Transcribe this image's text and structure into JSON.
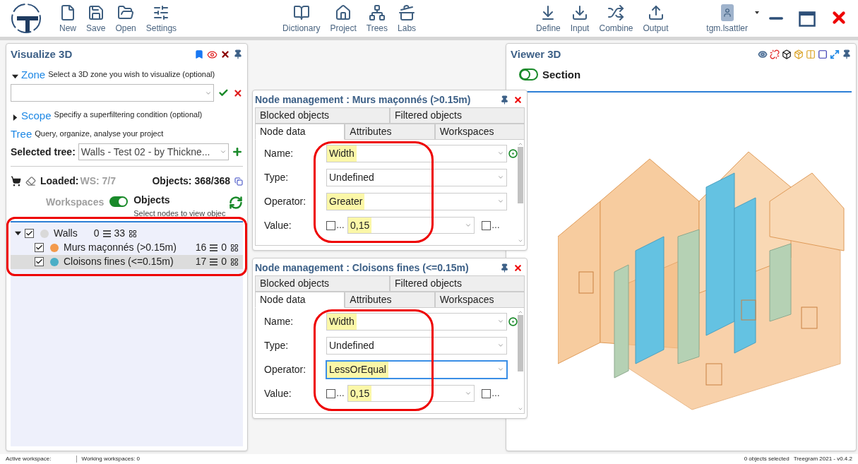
{
  "toolbar": {
    "groups": [
      [
        {
          "label": "New"
        },
        {
          "label": "Save"
        },
        {
          "label": "Open"
        },
        {
          "label": "Settings"
        }
      ],
      [
        {
          "label": "Dictionary"
        },
        {
          "label": "Project"
        },
        {
          "label": "Trees"
        },
        {
          "label": "Labs"
        }
      ],
      [
        {
          "label": "Define"
        },
        {
          "label": "Input"
        },
        {
          "label": "Combine"
        },
        {
          "label": "Output"
        }
      ]
    ],
    "user": "tgm.lsattler"
  },
  "visualize": {
    "title": "Visualize 3D",
    "zone": {
      "label": "Zone",
      "hint": "Select a 3D zone you wish to visualize (optional)",
      "expanded": true
    },
    "scope": {
      "label": "Scope",
      "hint": "Specifiy a superfiltering condition (optional)",
      "expanded": false
    },
    "tree": {
      "label": "Tree",
      "hint": "Query, organize, analyse your project"
    },
    "selected_tree": {
      "label": "Selected tree:",
      "value": "Walls - Test 02 - by Thickne..."
    },
    "loaded": {
      "label": "Loaded:",
      "ws": "WS: 7/7",
      "objects": "Objects: 368/368"
    },
    "mode_toggle": {
      "left": "Workspaces",
      "right": "Objects",
      "on": true,
      "hint": "Select nodes to view objec"
    },
    "nodes": [
      {
        "label": "Walls",
        "count_a": "0",
        "count_b": "33",
        "checked": true,
        "expanded": true,
        "selected": false,
        "color": "#d9d9d9",
        "children": [
          {
            "label": "Murs maçonnés (>0.15m)",
            "count_a": "16",
            "count_b": "0",
            "checked": true,
            "selected": false,
            "color": "#f39a4c"
          },
          {
            "label": "Cloisons fines (<=0.15m)",
            "count_a": "17",
            "count_b": "0",
            "checked": true,
            "selected": true,
            "color": "#4aaec6"
          }
        ]
      }
    ]
  },
  "node_panels": [
    {
      "title": "Node management : Murs maçonnés (>0.15m)",
      "tab_rows": [
        [
          {
            "label": "Blocked objects",
            "selected": false
          },
          {
            "label": "Filtered objects",
            "selected": false
          }
        ],
        [
          {
            "label": "Node data",
            "selected": true
          },
          {
            "label": "Attributes",
            "selected": false
          },
          {
            "label": "Workspaces",
            "selected": false
          }
        ]
      ],
      "fields": [
        {
          "kind": "text",
          "label": "Name:",
          "value": "Width",
          "highlighted": true,
          "focused": false
        },
        {
          "kind": "select",
          "label": "Type:",
          "value": "Undefined",
          "highlighted": false,
          "focused": false
        },
        {
          "kind": "select",
          "label": "Operator:",
          "value": "Greater",
          "highlighted": true,
          "focused": false
        },
        {
          "kind": "range",
          "label": "Value:",
          "value": "0,15",
          "highlighted": true,
          "left_check": "…",
          "right_check": "…",
          "left_checked": false,
          "right_checked": false
        }
      ]
    },
    {
      "title": "Node management : Cloisons fines (<=0.15m)",
      "tab_rows": [
        [
          {
            "label": "Blocked objects",
            "selected": false
          },
          {
            "label": "Filtered objects",
            "selected": false
          }
        ],
        [
          {
            "label": "Node data",
            "selected": true
          },
          {
            "label": "Attributes",
            "selected": false
          },
          {
            "label": "Workspaces",
            "selected": false
          }
        ]
      ],
      "fields": [
        {
          "kind": "text",
          "label": "Name:",
          "value": "Width",
          "highlighted": true,
          "focused": false
        },
        {
          "kind": "select",
          "label": "Type:",
          "value": "Undefined",
          "highlighted": false,
          "focused": false
        },
        {
          "kind": "select",
          "label": "Operator:",
          "value": "LessOrEqual",
          "highlighted": true,
          "focused": true
        },
        {
          "kind": "range",
          "label": "Value:",
          "value": "0,15",
          "highlighted": true,
          "left_check": "…",
          "right_check": "…",
          "left_checked": false,
          "right_checked": false
        }
      ]
    }
  ],
  "viewer": {
    "title": "Viewer 3D",
    "section": {
      "label": "Section",
      "on": false
    }
  },
  "status_bar": {
    "active_workspace": "Active workspace:",
    "working_workspaces": "Working workspaces: 0",
    "selection": "0 objects selected",
    "version": "Treegram 2021 - v0.4.2"
  }
}
